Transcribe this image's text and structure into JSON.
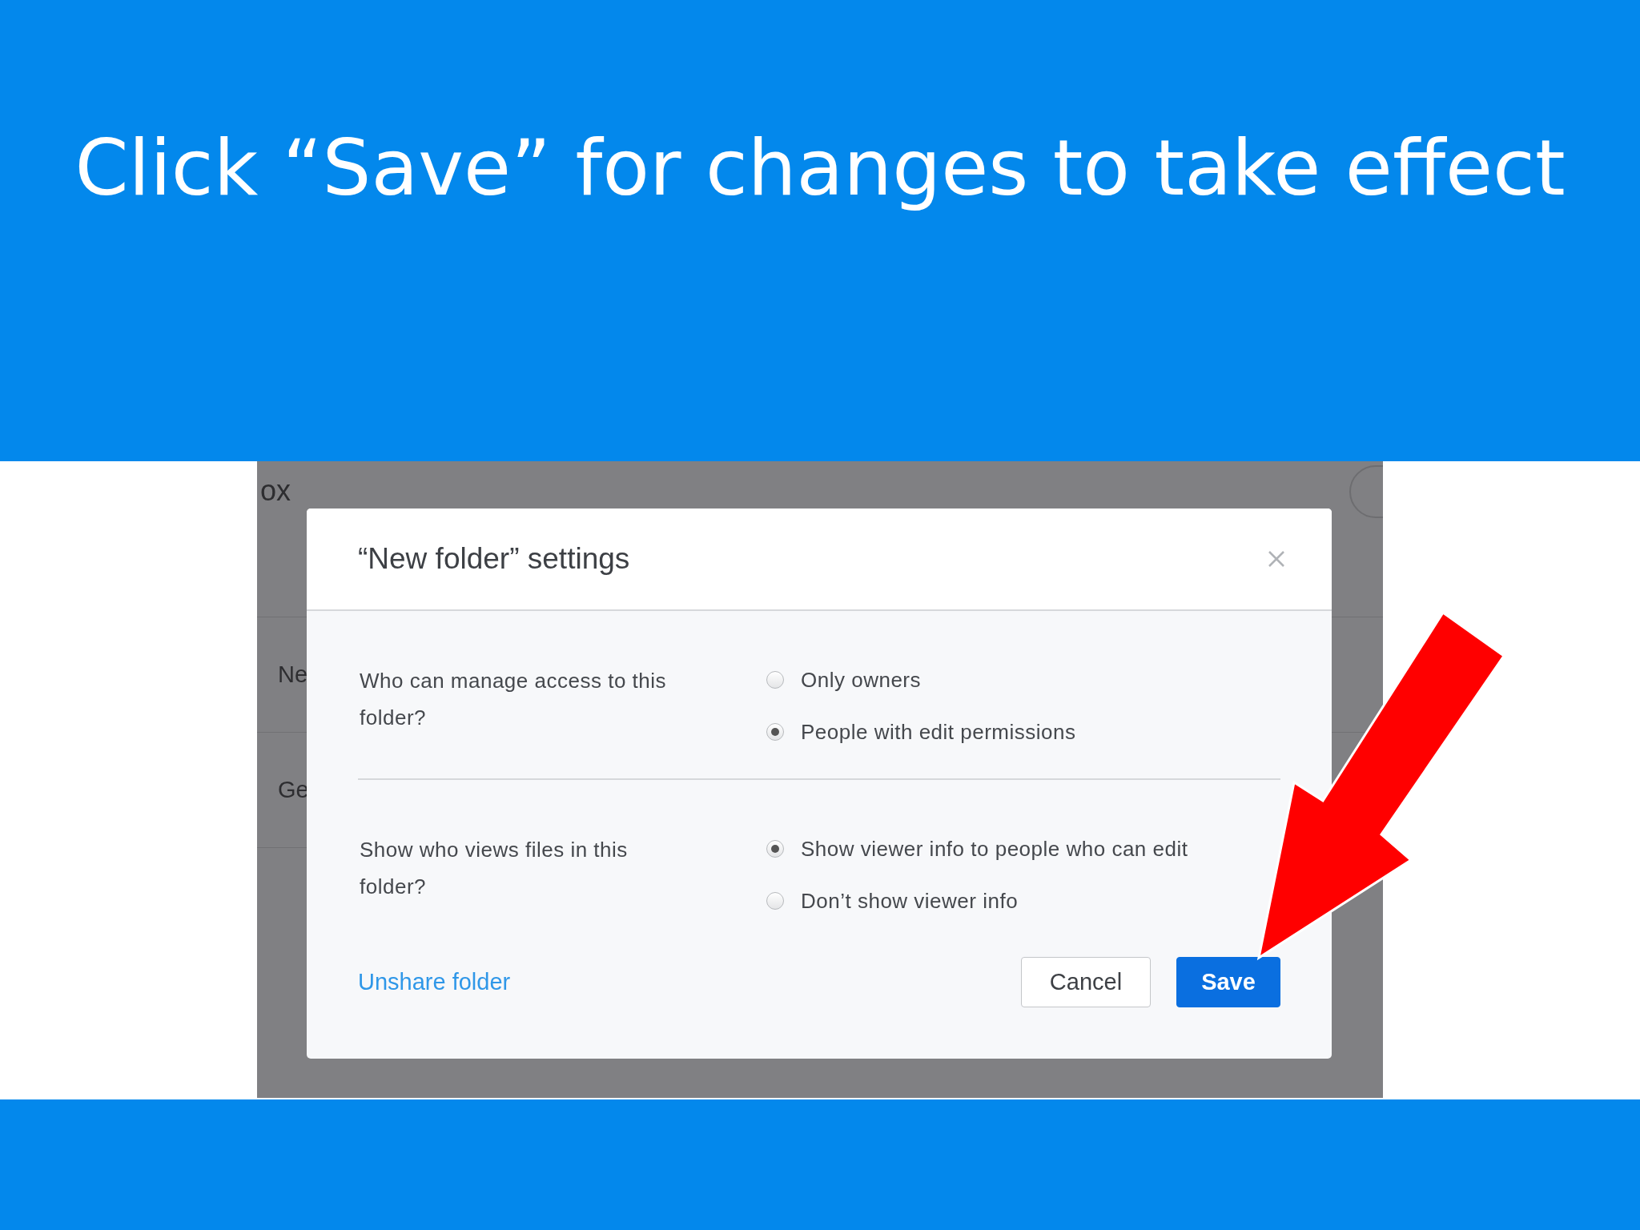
{
  "slide": {
    "title": "Click “Save” for changes to take effect"
  },
  "background": {
    "app_name": "ox",
    "rows": [
      "Ne",
      "Ge"
    ]
  },
  "dialog": {
    "title": "“New folder” settings",
    "settings": [
      {
        "question": "Who can manage access to this folder?",
        "options": [
          {
            "label": "Only owners",
            "selected": false
          },
          {
            "label": "People with edit permissions",
            "selected": true
          }
        ]
      },
      {
        "question": "Show who views files in this folder?",
        "options": [
          {
            "label": "Show viewer info to people who can edit",
            "selected": true
          },
          {
            "label": "Don’t show viewer info",
            "selected": false
          }
        ]
      }
    ],
    "link": "Unshare folder",
    "buttons": [
      {
        "label": "Cancel",
        "kind": "secondary"
      },
      {
        "label": "Save",
        "kind": "primary"
      }
    ]
  }
}
